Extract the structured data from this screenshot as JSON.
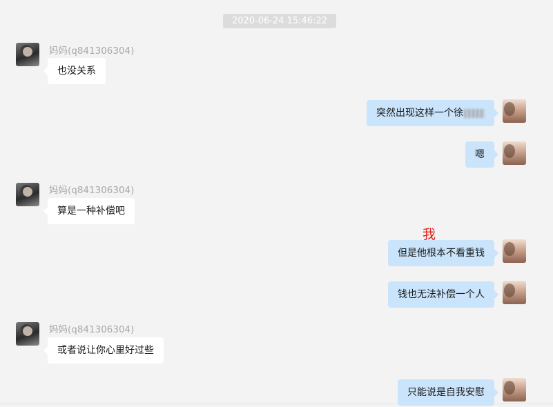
{
  "timestamp": "2020-06-24 15:46:22",
  "annotation": "我",
  "messages": [
    {
      "side": "left",
      "sender": "妈妈(q841306304)",
      "text": "也没关系"
    },
    {
      "side": "right",
      "text": "突然出现这样一个徐"
    },
    {
      "side": "right",
      "text": "嗯"
    },
    {
      "side": "left",
      "sender": "妈妈(q841306304)",
      "text": "算是一种补偿吧"
    },
    {
      "side": "right",
      "text": "但是他根本不看重钱"
    },
    {
      "side": "right",
      "text": "钱也无法补偿一个人"
    },
    {
      "side": "left",
      "sender": "妈妈(q841306304)",
      "text": "或者说让你心里好过些"
    },
    {
      "side": "right",
      "text": "只能说是自我安慰"
    }
  ],
  "colors": {
    "background": "#f3f3f3",
    "bubble_left": "#ffffff",
    "bubble_right": "#c9e4fb",
    "sender_text": "#a9a9a9",
    "annotation": "#e0201a"
  },
  "icons": {
    "left_avatar": "contact-avatar",
    "right_avatar": "self-avatar"
  }
}
